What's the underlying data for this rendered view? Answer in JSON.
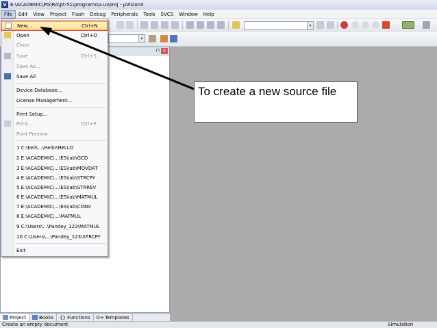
{
  "window": {
    "title": "E:\\ACADEMIC\\PG\\RA\\pt-51\\programs\\a.uvproj - µVision4",
    "app_icon": "uvision-icon"
  },
  "menubar": {
    "items": [
      "File",
      "Edit",
      "View",
      "Project",
      "Flash",
      "Debug",
      "Peripherals",
      "Tools",
      "SVCS",
      "Window",
      "Help"
    ]
  },
  "file_menu": {
    "items": [
      {
        "label": "New...",
        "shortcut": "Ctrl+N",
        "icon": "new-file-icon"
      },
      {
        "label": "Open",
        "shortcut": "Ctrl+O",
        "icon": "open-folder-icon"
      },
      {
        "label": "Close",
        "shortcut": ""
      },
      {
        "label": "Save",
        "shortcut": "Ctrl+S",
        "icon": "save-icon"
      },
      {
        "label": "Save As...",
        "shortcut": ""
      },
      {
        "label": "Save All",
        "shortcut": "",
        "icon": "save-all-icon"
      },
      {
        "label": "Device Database...",
        "shortcut": ""
      },
      {
        "label": "License Management...",
        "shortcut": ""
      },
      {
        "label": "Print Setup...",
        "shortcut": ""
      },
      {
        "label": "Print...",
        "shortcut": "Ctrl+P",
        "icon": "print-icon"
      },
      {
        "label": "Print Preview",
        "shortcut": ""
      },
      {
        "label": "1 C:\\Keil\\...\\Hello\\HELLO",
        "shortcut": ""
      },
      {
        "label": "2 E:\\ACADEMIC\\...\\ES\\lab\\GCD",
        "shortcut": ""
      },
      {
        "label": "3 E:\\ACADEMIC\\...\\ES\\lab\\MOVDAT",
        "shortcut": ""
      },
      {
        "label": "4 E:\\ACADEMIC\\...\\ES\\lab\\STRCPY",
        "shortcut": ""
      },
      {
        "label": "5 E:\\ACADEMIC\\...\\ES\\lab\\STRREV",
        "shortcut": ""
      },
      {
        "label": "6 E:\\ACADEMIC\\...\\ES\\lab\\MATMUL",
        "shortcut": ""
      },
      {
        "label": "7 E:\\ACADEMIC\\...\\ES\\lab\\CONV",
        "shortcut": ""
      },
      {
        "label": "8 E:\\ACADEMIC\\...\\MATMUL",
        "shortcut": ""
      },
      {
        "label": "9 C:\\Users\\...\\Pandey_123\\MATMUL",
        "shortcut": ""
      },
      {
        "label": "10 C:\\Users\\...\\Pandey_123\\STRCPY",
        "shortcut": ""
      },
      {
        "label": "Exit",
        "shortcut": ""
      }
    ]
  },
  "bottom_tabs": [
    "Project",
    "Books",
    "{} Functions",
    "0→ Templates"
  ],
  "statusbar": {
    "left": "Create an empty document",
    "right": "Simulation"
  },
  "callout": {
    "text": "To create a new source file"
  },
  "colors": {
    "highlight_border": "#e14a4a",
    "arrow": "#000000",
    "workspace": "#ababab"
  }
}
